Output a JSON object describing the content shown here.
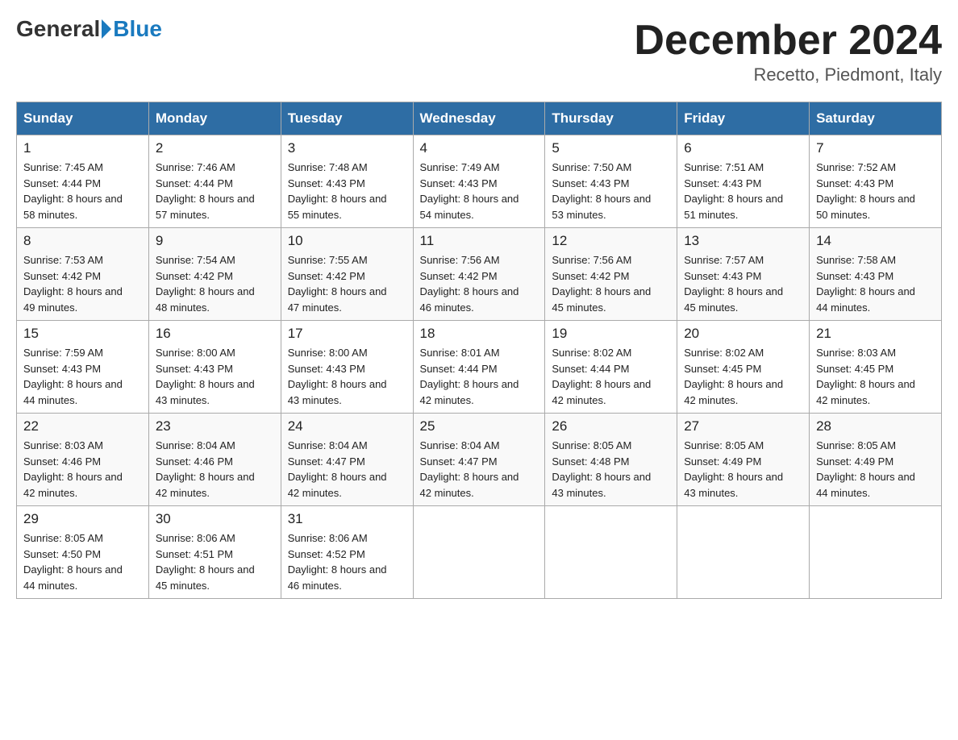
{
  "header": {
    "logo_general": "General",
    "logo_blue": "Blue",
    "title": "December 2024",
    "location": "Recetto, Piedmont, Italy"
  },
  "days_of_week": [
    "Sunday",
    "Monday",
    "Tuesday",
    "Wednesday",
    "Thursday",
    "Friday",
    "Saturday"
  ],
  "weeks": [
    [
      {
        "day": "1",
        "sunrise": "7:45 AM",
        "sunset": "4:44 PM",
        "daylight": "8 hours and 58 minutes."
      },
      {
        "day": "2",
        "sunrise": "7:46 AM",
        "sunset": "4:44 PM",
        "daylight": "8 hours and 57 minutes."
      },
      {
        "day": "3",
        "sunrise": "7:48 AM",
        "sunset": "4:43 PM",
        "daylight": "8 hours and 55 minutes."
      },
      {
        "day": "4",
        "sunrise": "7:49 AM",
        "sunset": "4:43 PM",
        "daylight": "8 hours and 54 minutes."
      },
      {
        "day": "5",
        "sunrise": "7:50 AM",
        "sunset": "4:43 PM",
        "daylight": "8 hours and 53 minutes."
      },
      {
        "day": "6",
        "sunrise": "7:51 AM",
        "sunset": "4:43 PM",
        "daylight": "8 hours and 51 minutes."
      },
      {
        "day": "7",
        "sunrise": "7:52 AM",
        "sunset": "4:43 PM",
        "daylight": "8 hours and 50 minutes."
      }
    ],
    [
      {
        "day": "8",
        "sunrise": "7:53 AM",
        "sunset": "4:42 PM",
        "daylight": "8 hours and 49 minutes."
      },
      {
        "day": "9",
        "sunrise": "7:54 AM",
        "sunset": "4:42 PM",
        "daylight": "8 hours and 48 minutes."
      },
      {
        "day": "10",
        "sunrise": "7:55 AM",
        "sunset": "4:42 PM",
        "daylight": "8 hours and 47 minutes."
      },
      {
        "day": "11",
        "sunrise": "7:56 AM",
        "sunset": "4:42 PM",
        "daylight": "8 hours and 46 minutes."
      },
      {
        "day": "12",
        "sunrise": "7:56 AM",
        "sunset": "4:42 PM",
        "daylight": "8 hours and 45 minutes."
      },
      {
        "day": "13",
        "sunrise": "7:57 AM",
        "sunset": "4:43 PM",
        "daylight": "8 hours and 45 minutes."
      },
      {
        "day": "14",
        "sunrise": "7:58 AM",
        "sunset": "4:43 PM",
        "daylight": "8 hours and 44 minutes."
      }
    ],
    [
      {
        "day": "15",
        "sunrise": "7:59 AM",
        "sunset": "4:43 PM",
        "daylight": "8 hours and 44 minutes."
      },
      {
        "day": "16",
        "sunrise": "8:00 AM",
        "sunset": "4:43 PM",
        "daylight": "8 hours and 43 minutes."
      },
      {
        "day": "17",
        "sunrise": "8:00 AM",
        "sunset": "4:43 PM",
        "daylight": "8 hours and 43 minutes."
      },
      {
        "day": "18",
        "sunrise": "8:01 AM",
        "sunset": "4:44 PM",
        "daylight": "8 hours and 42 minutes."
      },
      {
        "day": "19",
        "sunrise": "8:02 AM",
        "sunset": "4:44 PM",
        "daylight": "8 hours and 42 minutes."
      },
      {
        "day": "20",
        "sunrise": "8:02 AM",
        "sunset": "4:45 PM",
        "daylight": "8 hours and 42 minutes."
      },
      {
        "day": "21",
        "sunrise": "8:03 AM",
        "sunset": "4:45 PM",
        "daylight": "8 hours and 42 minutes."
      }
    ],
    [
      {
        "day": "22",
        "sunrise": "8:03 AM",
        "sunset": "4:46 PM",
        "daylight": "8 hours and 42 minutes."
      },
      {
        "day": "23",
        "sunrise": "8:04 AM",
        "sunset": "4:46 PM",
        "daylight": "8 hours and 42 minutes."
      },
      {
        "day": "24",
        "sunrise": "8:04 AM",
        "sunset": "4:47 PM",
        "daylight": "8 hours and 42 minutes."
      },
      {
        "day": "25",
        "sunrise": "8:04 AM",
        "sunset": "4:47 PM",
        "daylight": "8 hours and 42 minutes."
      },
      {
        "day": "26",
        "sunrise": "8:05 AM",
        "sunset": "4:48 PM",
        "daylight": "8 hours and 43 minutes."
      },
      {
        "day": "27",
        "sunrise": "8:05 AM",
        "sunset": "4:49 PM",
        "daylight": "8 hours and 43 minutes."
      },
      {
        "day": "28",
        "sunrise": "8:05 AM",
        "sunset": "4:49 PM",
        "daylight": "8 hours and 44 minutes."
      }
    ],
    [
      {
        "day": "29",
        "sunrise": "8:05 AM",
        "sunset": "4:50 PM",
        "daylight": "8 hours and 44 minutes."
      },
      {
        "day": "30",
        "sunrise": "8:06 AM",
        "sunset": "4:51 PM",
        "daylight": "8 hours and 45 minutes."
      },
      {
        "day": "31",
        "sunrise": "8:06 AM",
        "sunset": "4:52 PM",
        "daylight": "8 hours and 46 minutes."
      },
      null,
      null,
      null,
      null
    ]
  ]
}
